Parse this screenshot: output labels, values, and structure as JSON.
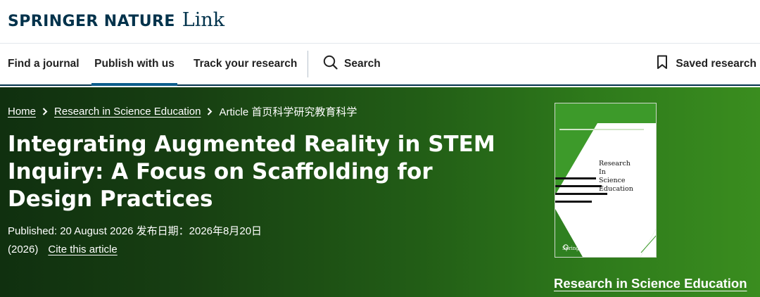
{
  "brand": {
    "name": "SPRINGER NATURE",
    "product": "Link"
  },
  "nav": {
    "find_journal": "Find a journal",
    "publish": "Publish with us",
    "track": "Track your research",
    "search": "Search",
    "saved": "Saved research"
  },
  "breadcrumb": {
    "home": "Home",
    "journal": "Research in Science Education",
    "current": "Article 首页科学研究教育科学"
  },
  "article": {
    "title": "Integrating Augmented Reality in STEM Inquiry: A Focus on Scaffolding for Design Practices",
    "published": "Published: 20 August 2026  发布日期：2026年8月20日",
    "year": "(2026)",
    "cite": "Cite this article"
  },
  "journal": {
    "link": "Research in Science Education",
    "cover_title": [
      "Research",
      "In",
      "Science",
      "Education"
    ],
    "cover_publisher": "Springer"
  },
  "colors": {
    "brand_navy": "#01324b",
    "nav_underline": "#0c5d8c",
    "hero_green": "#2e7a1b",
    "cover_green": "#3d9a2a"
  }
}
